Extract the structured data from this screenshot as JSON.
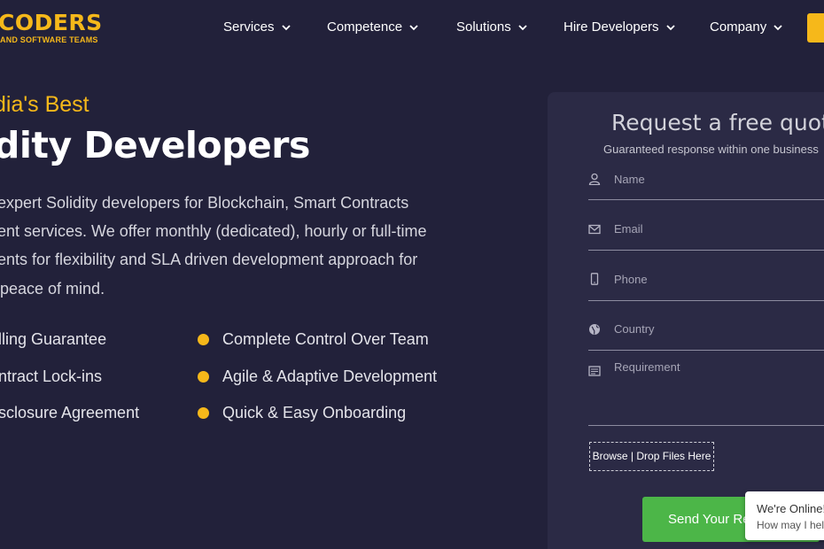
{
  "header": {
    "logo": {
      "name": "CODERS",
      "tagline": "AND SOFTWARE TEAMS"
    },
    "nav": [
      {
        "label": "Services"
      },
      {
        "label": "Competence"
      },
      {
        "label": "Solutions"
      },
      {
        "label": "Hire Developers"
      },
      {
        "label": "Company"
      }
    ],
    "accent_color": "#f6b81a"
  },
  "hero": {
    "eyebrow": "dia's Best",
    "headline": "dity Developers",
    "description_lines": [
      "expert Solidity developers for Blockchain, Smart Contracts",
      "ent services. We offer monthly (dedicated), hourly or full-time",
      "ents for flexibility and SLA driven development approach for",
      "peace of mind."
    ],
    "features_left": [
      "lling Guarantee",
      "ntract Lock-ins",
      "sclosure Agreement"
    ],
    "features_right": [
      "Complete Control Over Team",
      "Agile & Adaptive Development",
      "Quick & Easy Onboarding"
    ]
  },
  "form": {
    "title": "Request a free quot",
    "subtitle": "Guaranteed response within one business",
    "fields": [
      {
        "placeholder": "Name",
        "icon": "user-icon"
      },
      {
        "placeholder": "Email",
        "icon": "envelope-icon"
      },
      {
        "placeholder": "Phone",
        "icon": "phone-icon"
      },
      {
        "placeholder": "Country",
        "icon": "globe-icon"
      },
      {
        "placeholder": "Requirement",
        "icon": "document-icon"
      }
    ],
    "browse_label": "Browse | Drop Files Here",
    "submit_label": "Send Your Re",
    "submit_color": "#4cb648"
  },
  "chat": {
    "status": "We're Online!",
    "prompt": "How may I hel"
  }
}
